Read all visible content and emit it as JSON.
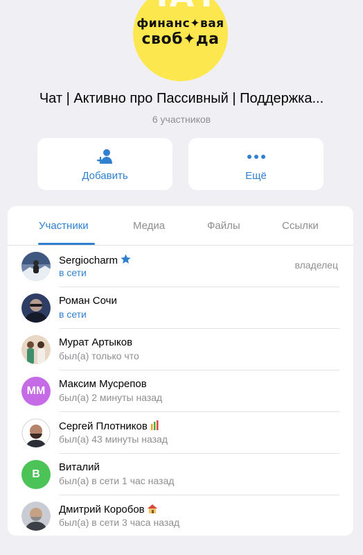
{
  "group": {
    "avatar_watermark": "ЧАТ",
    "avatar_line1": "финанс✦вая",
    "avatar_line2": "своб✦да",
    "title": "Чат | Активно про Пассивный | Поддержка...",
    "member_count": "6 участников"
  },
  "actions": {
    "add_label": "Добавить",
    "more_label": "Ещё"
  },
  "tabs": [
    {
      "label": "Участники",
      "active": true
    },
    {
      "label": "Медиа",
      "active": false
    },
    {
      "label": "Файлы",
      "active": false
    },
    {
      "label": "Ссылки",
      "active": false
    }
  ],
  "members": [
    {
      "name": "Sergiocharm",
      "status": "в сети",
      "online": true,
      "role": "владелец",
      "badge": "star-icon"
    },
    {
      "name": "Роман Сочи",
      "status": "в сети",
      "online": true
    },
    {
      "name": "Мурат Артыков",
      "status": "был(а) только что",
      "online": false
    },
    {
      "name": "Максим Мусрепов",
      "status": "был(а) 2 минуты назад",
      "online": false,
      "initials": "ММ"
    },
    {
      "name": "Сергей Плотников",
      "status": "был(а) 43 минуты назад",
      "online": false,
      "badge": "money-bag-icon"
    },
    {
      "name": "Виталий",
      "status": "был(а) в сети 1 час назад",
      "online": false,
      "initials": "В"
    },
    {
      "name": "Дмитрий Коробов",
      "status": "был(а) в сети 3 часа назад",
      "online": false,
      "badge": "house-icon"
    }
  ],
  "colors": {
    "accent": "#2f80d1",
    "background": "#efeff4",
    "avatar_yellow": "#fde74f",
    "initials_purple": "#c56be6",
    "initials_green": "#4cc357"
  }
}
